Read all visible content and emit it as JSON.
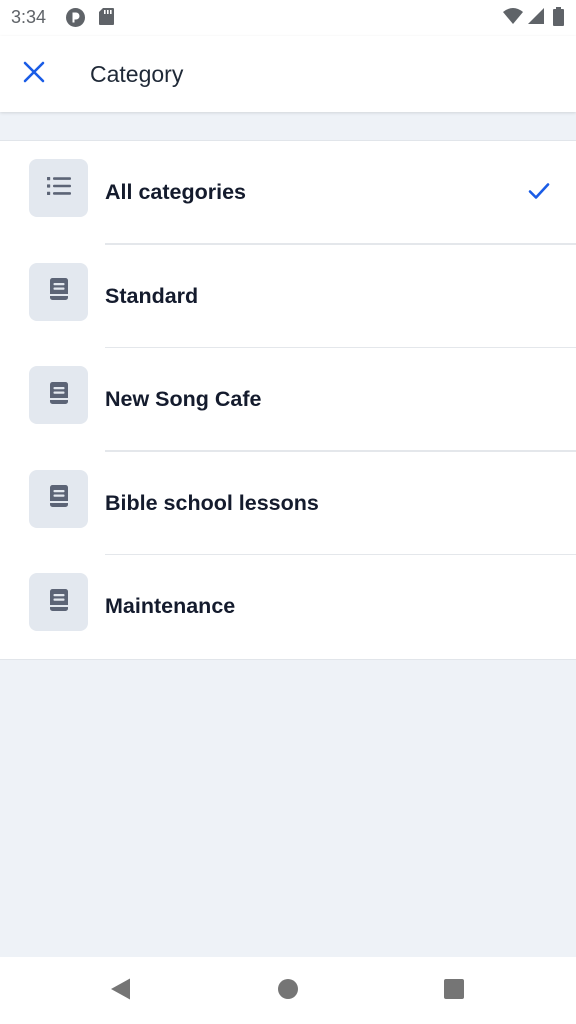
{
  "status_bar": {
    "time": "3:34",
    "left_icons": [
      "nextcloud-icon",
      "sd-card-icon"
    ],
    "right_icons": [
      "wifi-icon",
      "cellular-signal-icon",
      "battery-icon"
    ]
  },
  "app_bar": {
    "close_icon": "close-icon",
    "title": "Category",
    "accent_color": "#1a5ce6"
  },
  "categories": [
    {
      "label": "All categories",
      "icon": "list-icon",
      "selected": true
    },
    {
      "label": "Standard",
      "icon": "book-icon",
      "selected": false
    },
    {
      "label": "New Song Cafe",
      "icon": "book-icon",
      "selected": false
    },
    {
      "label": "Bible school lessons",
      "icon": "book-icon",
      "selected": false
    },
    {
      "label": "Maintenance",
      "icon": "book-icon",
      "selected": false
    }
  ],
  "nav_bar": {
    "icons": [
      "back-icon",
      "home-icon",
      "recents-icon"
    ]
  },
  "colors": {
    "background": "#eef2f7",
    "icon_box": "#e3e8ef",
    "icon_fill": "#5c6476",
    "text": "#141b2d"
  }
}
